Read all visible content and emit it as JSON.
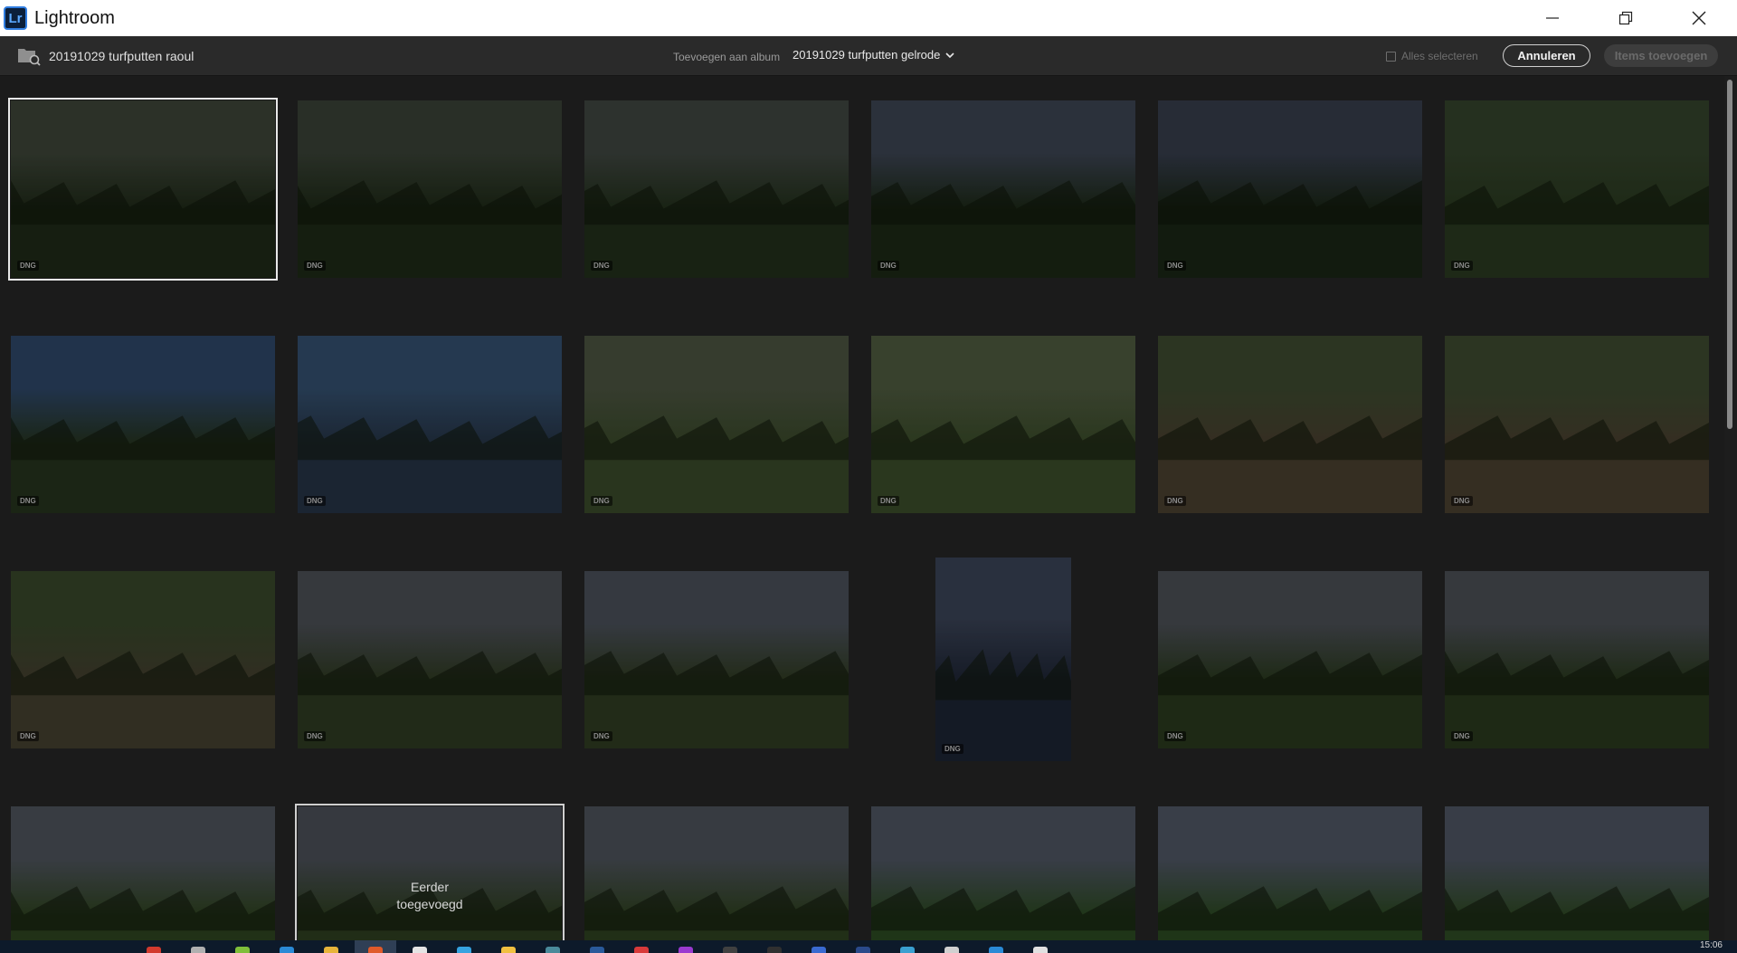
{
  "window": {
    "app_name": "Lightroom",
    "logo_text": "Lr",
    "controls": [
      "minimize-icon",
      "restore-icon",
      "close-icon"
    ]
  },
  "toolbar": {
    "folder_name": "20191029 turfputten raoul",
    "album_label": "Toevoegen aan album",
    "album_value": "20191029 turfputten gelrode",
    "select_all_label": "Alles selecteren",
    "cancel_label": "Annuleren",
    "add_label": "Items toevoegen"
  },
  "grid": {
    "thumbnails": [
      {
        "badge": "DNG",
        "selected": true,
        "c1": "#3d4538",
        "c2": "#1f2a18"
      },
      {
        "badge": "DNG",
        "c1": "#394236",
        "c2": "#1e2a17"
      },
      {
        "badge": "DNG",
        "c1": "#3f4640",
        "c2": "#22301b"
      },
      {
        "badge": "DNG",
        "c1": "#3c4452",
        "c2": "#1c2916"
      },
      {
        "badge": "DNG",
        "c1": "#363d4c",
        "c2": "#1a2615"
      },
      {
        "badge": "DNG",
        "c1": "#34432b",
        "c2": "#2a3a20"
      },
      {
        "badge": "DNG",
        "c1": "#2e4768",
        "c2": "#26341e"
      },
      {
        "badge": "DNG",
        "c1": "#34506f",
        "c2": "#263446"
      },
      {
        "badge": "DNG",
        "c1": "#4b5440",
        "c2": "#3a4a2a"
      },
      {
        "badge": "DNG",
        "c1": "#4e5a3f",
        "c2": "#3b4d2a"
      },
      {
        "badge": "DNG",
        "c1": "#3e4a30",
        "c2": "#4a4030"
      },
      {
        "badge": "DNG",
        "c1": "#3d4a30",
        "c2": "#4a4030"
      },
      {
        "badge": "DNG",
        "c1": "#38472a",
        "c2": "#454030"
      },
      {
        "badge": "DNG",
        "c1": "#4b4f55",
        "c2": "#2f3b22"
      },
      {
        "badge": "DNG",
        "c1": "#4a5059",
        "c2": "#303c22"
      },
      {
        "badge": "DNG",
        "portrait": true,
        "c1": "#3a4356",
        "c2": "#1d2434"
      },
      {
        "badge": "DNG",
        "c1": "#4b4f55",
        "c2": "#2a3a1e"
      },
      {
        "badge": "DNG",
        "c1": "#4b4f55",
        "c2": "#2a3a1e"
      },
      {
        "badge": "",
        "c1": "#4e545c",
        "c2": "#2f4420"
      },
      {
        "badge": "",
        "added": true,
        "c1": "#4b5058",
        "c2": "#2e3f20"
      },
      {
        "badge": "",
        "c1": "#4d535a",
        "c2": "#2f4220"
      },
      {
        "badge": "",
        "c1": "#4e5562",
        "c2": "#2c4a22"
      },
      {
        "badge": "",
        "c1": "#4f5664",
        "c2": "#2c4a22"
      },
      {
        "badge": "",
        "c1": "#4e5563",
        "c2": "#2f4b24"
      }
    ],
    "added_text": "Eerder\ntoegevoegd"
  },
  "taskbar": {
    "clock": "15:06",
    "icon_colors": [
      "#d23a2e",
      "#b0b0b0",
      "#7fbf3a",
      "#2a8ad6",
      "#e7b43a",
      "#e05a2a",
      "#e4e4e4",
      "#36a3e0",
      "#f0c040",
      "#4a8a9a",
      "#2a5a9a",
      "#d83a3a",
      "#9a3ad0",
      "#404040",
      "#303030",
      "#3a6ad0",
      "#2a4a8a",
      "#3aa0d0",
      "#d0d0d0",
      "#2a8ad6",
      "#e0e0e0"
    ]
  }
}
